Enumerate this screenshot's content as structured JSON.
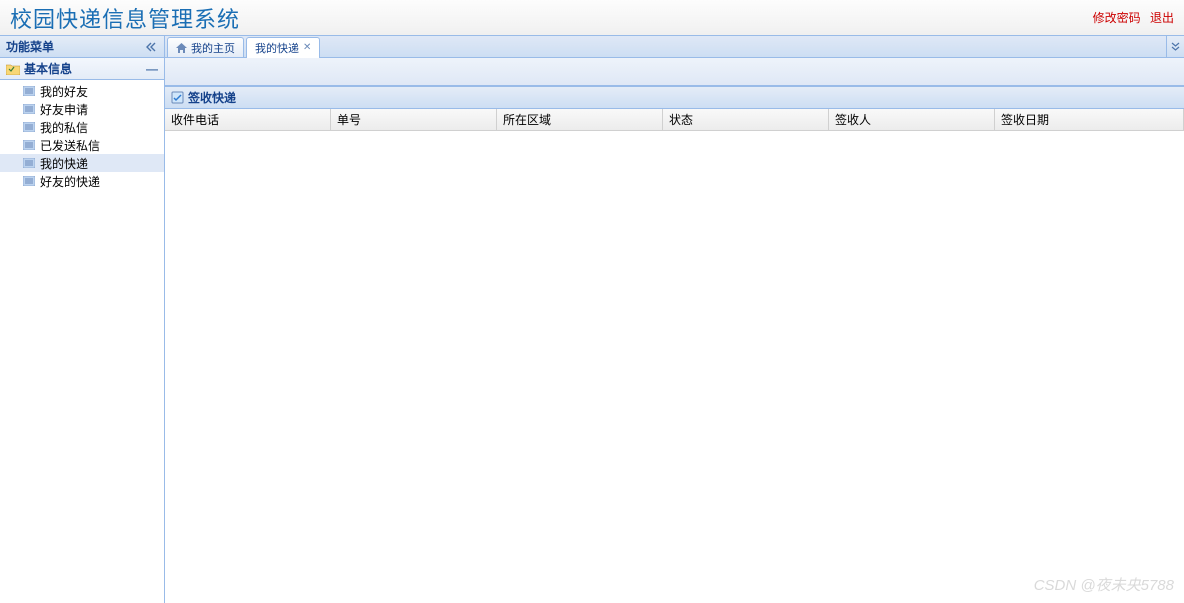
{
  "header": {
    "title": "校园快递信息管理系统",
    "links": {
      "change_pw": "修改密码",
      "logout": "退出"
    }
  },
  "sidebar": {
    "title": "功能菜单",
    "group": {
      "label": "基本信息"
    },
    "items": [
      {
        "label": "我的好友"
      },
      {
        "label": "好友申请"
      },
      {
        "label": "我的私信"
      },
      {
        "label": "已发送私信"
      },
      {
        "label": "我的快递"
      },
      {
        "label": "好友的快递"
      }
    ]
  },
  "tabs": [
    {
      "label": "我的主页",
      "home": true
    },
    {
      "label": "我的快递",
      "closable": true,
      "active": true
    }
  ],
  "grid": {
    "title": "签收快递",
    "columns": [
      "收件电话",
      "单号",
      "所在区域",
      "状态",
      "签收人",
      "签收日期"
    ]
  },
  "watermark": "CSDN @夜未央5788"
}
